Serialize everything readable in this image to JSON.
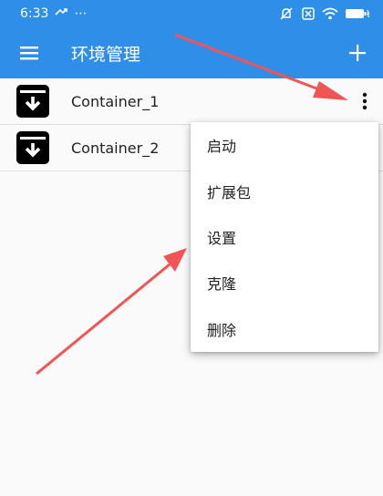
{
  "status_bar": {
    "time": "6:33",
    "extra": "⋯"
  },
  "app_bar": {
    "title": "环境管理",
    "menu_icon": "hamburger-menu-icon",
    "add_icon": "plus-icon",
    "add_label": "+"
  },
  "containers": [
    {
      "name": "Container_1",
      "icon": "archive-box-icon"
    },
    {
      "name": "Container_2",
      "icon": "archive-box-icon"
    }
  ],
  "popup_menu": {
    "items": [
      "启动",
      "扩展包",
      "设置",
      "克隆",
      "删除"
    ]
  },
  "colors": {
    "primary": "#2f8ee8",
    "annotation_arrow": "#f05454"
  }
}
